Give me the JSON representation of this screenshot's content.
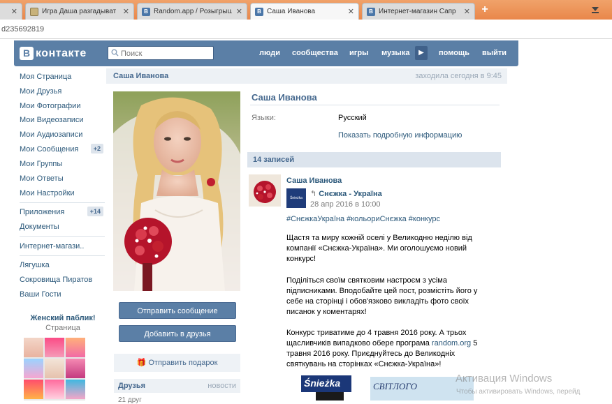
{
  "browser": {
    "tabs": [
      {
        "title": "",
        "favicon": "blank"
      },
      {
        "title": "Игра Даша разгадыват",
        "favicon": "game"
      },
      {
        "title": "Random.app / Розыгрыш",
        "favicon": "vk"
      },
      {
        "title": "Саша Иванова",
        "favicon": "vk",
        "active": true
      },
      {
        "title": "Интернет-магазин Сапр",
        "favicon": "vk"
      }
    ],
    "new_tab": "+",
    "url": "d235692819"
  },
  "header": {
    "logo_letter": "В",
    "logo_word": "контакте",
    "search_placeholder": "Поиск",
    "nav": [
      "люди",
      "сообщества",
      "игры",
      "музыка",
      "помощь",
      "выйти"
    ],
    "play_icon": "play-icon"
  },
  "left_menu": {
    "items": [
      {
        "label": "Моя Страница"
      },
      {
        "label": "Мои Друзья"
      },
      {
        "label": "Мои Фотографии"
      },
      {
        "label": "Мои Видеозаписи"
      },
      {
        "label": "Мои Аудиозаписи"
      },
      {
        "label": "Мои Сообщения",
        "count": "+2"
      },
      {
        "label": "Мои Группы"
      },
      {
        "label": "Мои Ответы"
      },
      {
        "label": "Мои Настройки"
      },
      {
        "label": "Приложения",
        "count": "+14"
      },
      {
        "label": "Документы"
      },
      {
        "label": "Интернет-магази.."
      },
      {
        "label": "Лягушка"
      },
      {
        "label": "Сокровища Пиратов"
      },
      {
        "label": "Ваши Гости"
      }
    ],
    "ad": {
      "title": "Женский паблик!",
      "subtitle": "Страница"
    }
  },
  "profile": {
    "name": "Саша Иванова",
    "last_seen": "заходила сегодня в 9:45",
    "language_label": "Языки:",
    "language_value": "Русский",
    "show_more": "Показать подробную информацию",
    "send_message": "Отправить сообщение",
    "add_friend": "Добавить в друзья",
    "send_gift": "Отправить подарок",
    "friends_title": "Друзья",
    "friends_news": "новости",
    "friends_count": "21 друг"
  },
  "wall": {
    "count": "14 записей",
    "post": {
      "author": "Саша Иванова",
      "source": "Снєжка - Україна",
      "source_logo": "Śnieżka",
      "date": "28 апр 2016 в 10:00",
      "tags": "#СнєжкаУкраїна #кольориСнєжка #конкурс",
      "paragraphs": [
        "Щастя та миру кожній оселі у Великодню неділю від компанії «Снєжка-Україна». Ми оголошуємо новий конкурс!",
        "Поділіться своїм святковим настроєм з усіма підписниками. Вподобайте цей пост, розмістіть його у себе на сторінці і обов'язково викладіть фото своїх писанок у коментарях!"
      ],
      "para3_a": "Конкурс триватиме до 4 травня 2016 року. А трьох щасливчиків випадково обере програма ",
      "para3_link": "random.org",
      "para3_b": " 5 травня 2016 року. Приєднуйтесь до Великодніх святкувань на сторінках «Снєжка-Україна»!",
      "banner1": "Śnieżka",
      "banner2": "СВІТЛОГО"
    }
  },
  "watermark": {
    "line1": "Активация Windows",
    "line2": "Чтобы активировать Windows, перейд"
  },
  "colors": {
    "vk_blue": "#5b7fa6",
    "link": "#2b587a",
    "tabbar": "#e9874a"
  }
}
